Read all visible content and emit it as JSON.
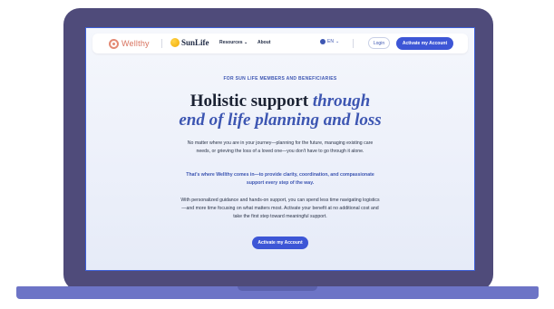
{
  "nav": {
    "wellthy_logo": "Wellthy",
    "sunlife_logo": "SunLife",
    "resources_label": "Resources",
    "about_label": "About",
    "language_label": "EN",
    "login_label": "Login",
    "activate_label": "Activate my Account"
  },
  "hero": {
    "eyebrow": "FOR SUN LIFE MEMBERS AND BENEFICIARIES",
    "title_line1_plain": "Holistic support",
    "title_line1_accent": "through",
    "title_line2": "end of life planning and loss",
    "paragraph1": "No matter where you are in your journey—planning for the future, managing existing care needs, or grieving the loss of a loved one—you don't have to go through it alone.",
    "paragraph2": "That's where Wellthy comes in—to provide clarity, coordination, and compassionate support every step of the way.",
    "paragraph3": "With personalized guidance and hands-on support, you can spend less time navigating logistics—and more time focusing on what matters most. Activate your benefit at no additional cost and take the first step toward meaningful support.",
    "cta_label": "Activate my Account"
  },
  "colors": {
    "laptop_frame": "#4f4b7a",
    "laptop_base": "#6d74c6",
    "accent_blue": "#3d56d6",
    "wellthy_coral": "#d8735f"
  },
  "icons": [
    "flower-logo-icon",
    "sun-logo-icon",
    "chevron-down-icon",
    "globe-icon"
  ]
}
